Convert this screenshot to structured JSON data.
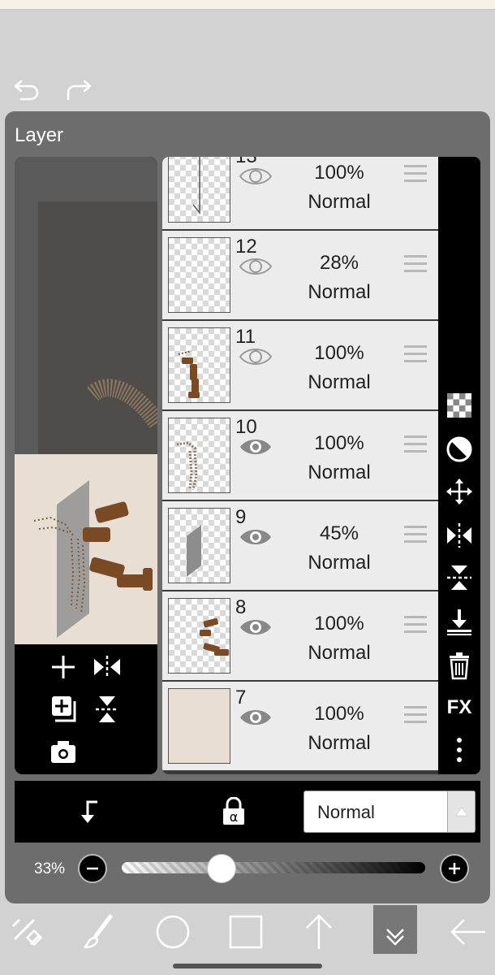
{
  "panel": {
    "title": "Layer"
  },
  "icons": {
    "undo": "undo-icon",
    "redo": "redo-icon",
    "add_layer": "plus-icon",
    "flip_h": "flip-horizontal-icon",
    "duplicate": "duplicate-layer-icon",
    "flip_v": "flip-vertical-icon",
    "camera": "camera-icon",
    "eye": "eye-icon",
    "handle": "drag-handle-icon"
  },
  "layers": [
    {
      "number": "13",
      "opacity": "100%",
      "blend": "Normal",
      "visible": true,
      "eye_style": "outline"
    },
    {
      "number": "12",
      "opacity": "28%",
      "blend": "Normal",
      "visible": true,
      "eye_style": "outline"
    },
    {
      "number": "11",
      "opacity": "100%",
      "blend": "Normal",
      "visible": true,
      "eye_style": "outline"
    },
    {
      "number": "10",
      "opacity": "100%",
      "blend": "Normal",
      "visible": true,
      "eye_style": "filled"
    },
    {
      "number": "9",
      "opacity": "45%",
      "blend": "Normal",
      "visible": true,
      "eye_style": "filled"
    },
    {
      "number": "8",
      "opacity": "100%",
      "blend": "Normal",
      "visible": true,
      "eye_style": "filled"
    },
    {
      "number": "7",
      "opacity": "100%",
      "blend": "Normal",
      "visible": true,
      "eye_style": "filled"
    }
  ],
  "right_tools": [
    {
      "name": "transparency-checker-icon"
    },
    {
      "name": "invert-contrast-icon"
    },
    {
      "name": "move-arrows-icon"
    },
    {
      "name": "flip-horizontal-icon"
    },
    {
      "name": "flip-vertical-icon"
    },
    {
      "name": "merge-down-icon"
    },
    {
      "name": "trash-icon"
    },
    {
      "name": "fx-icon",
      "label": "FX"
    },
    {
      "name": "more-vertical-icon"
    }
  ],
  "bottom_bar": {
    "blend_mode": "Normal",
    "clip_icon": "clipping-arrow-icon",
    "lock_icon": "alpha-lock-icon",
    "dropdown_icon": "triangle-up-icon"
  },
  "opacity_slider": {
    "value_label": "33%",
    "value": 0.33
  },
  "bottom_toolbar": [
    {
      "name": "transform-tool-icon"
    },
    {
      "name": "brush-tool-icon"
    },
    {
      "name": "ellipse-tool-icon"
    },
    {
      "name": "rectangle-tool-icon"
    },
    {
      "name": "arrow-up-icon"
    },
    {
      "name": "collapse-down-icon",
      "active": true
    },
    {
      "name": "back-arrow-icon"
    }
  ],
  "colors": {
    "panel_bg": "#6d6d6d",
    "row_bg": "#ececec",
    "canvas_bg": "#e8ded4",
    "accent_active": "#777777"
  }
}
